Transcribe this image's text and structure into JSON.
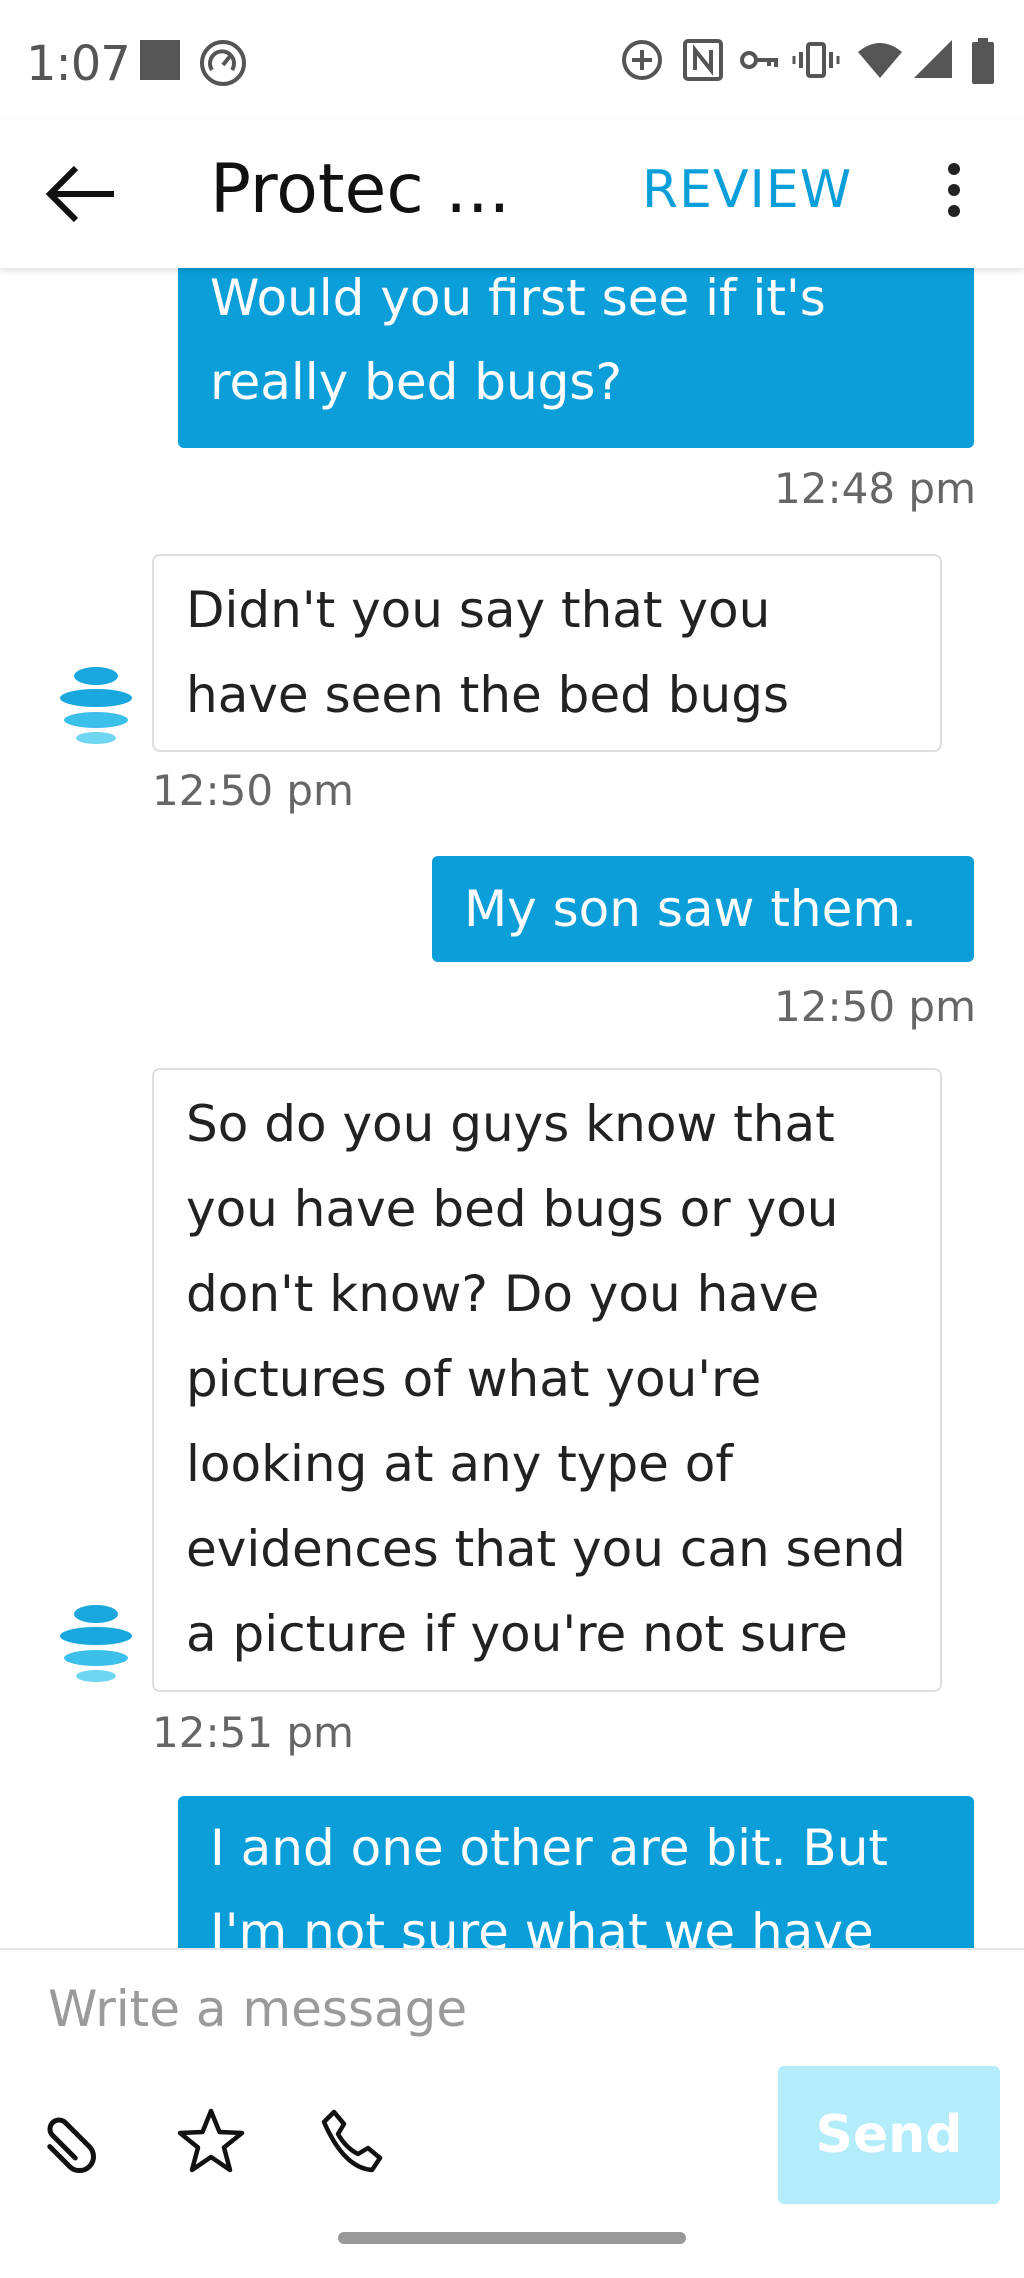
{
  "status_bar": {
    "time": "1:07",
    "icons": [
      "stop-square-icon",
      "speed-gauge-icon",
      "add-circle-icon",
      "nfc-icon",
      "vpn-key-icon",
      "vibrate-icon",
      "wifi-icon",
      "cell-signal-icon",
      "battery-icon"
    ]
  },
  "app_bar": {
    "title": "Protec ...",
    "review_label": "REVIEW",
    "icons": [
      "back-arrow-icon",
      "more-vert-icon"
    ]
  },
  "messages": [
    {
      "direction": "out",
      "lines": [
        "Would you first see if it's",
        "really bed bugs?"
      ],
      "time": "12:48 pm"
    },
    {
      "direction": "in",
      "lines": [
        "Didn't you say that you",
        "have seen the bed bugs"
      ],
      "time": "12:50 pm"
    },
    {
      "direction": "out",
      "lines": [
        "My son saw them."
      ],
      "time": "12:50 pm"
    },
    {
      "direction": "in",
      "lines": [
        "So do you guys know that",
        "you have bed bugs or you",
        "don't know? Do you have",
        "pictures of what you're",
        "looking at any type of",
        "evidences that you can send",
        "a picture if you're not sure"
      ],
      "time": "12:51 pm"
    },
    {
      "direction": "out",
      "lines": [
        "I and one other are bit. But",
        "I'm not sure what we have"
      ],
      "time": ""
    }
  ],
  "composer": {
    "placeholder": "Write a message",
    "value": "",
    "send_label": "Send",
    "icons": [
      "paperclip-icon",
      "star-icon",
      "phone-icon"
    ]
  },
  "colors": {
    "accent": "#0b9ed9",
    "send_disabled": "#b3ecfb"
  }
}
